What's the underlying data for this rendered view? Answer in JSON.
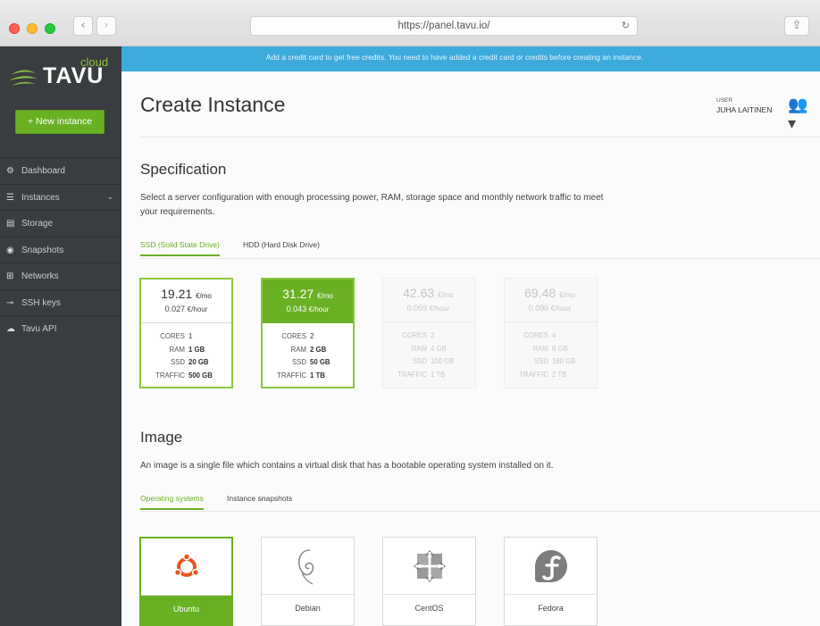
{
  "browser": {
    "url": "https://panel.tavu.io/",
    "back_icon": "‹",
    "forward_icon": "›",
    "sidebar_icon": "▯",
    "share_icon": "⇪",
    "reload_icon": "↻"
  },
  "brand": {
    "cloud": "cloud",
    "name": "TAVU",
    "accent_color": "#6ab023",
    "banner_color": "#3caadb"
  },
  "sidebar": {
    "new_instance_label": "+ New instance",
    "items": [
      {
        "label": "Dashboard",
        "icon": "⚙"
      },
      {
        "label": "Instances",
        "icon": "☰",
        "chevron": "⌄"
      },
      {
        "label": "Storage",
        "icon": "▤"
      },
      {
        "label": "Snapshots",
        "icon": "◉"
      },
      {
        "label": "Networks",
        "icon": "⊞"
      },
      {
        "label": "SSH keys",
        "icon": "⊸"
      },
      {
        "label": "Tavu API",
        "icon": "☁"
      }
    ]
  },
  "banner": {
    "text": "Add a credit card to get free credits. You need to have added a credit card or credits before creating an instance."
  },
  "header": {
    "title": "Create Instance",
    "user_label": "USER",
    "user_name": "JUHA LAITINEN",
    "user_icon": "👥▾"
  },
  "specification": {
    "title": "Specification",
    "description": "Select a server configuration with enough processing power, RAM, storage space and monthly network traffic to meet your requirements.",
    "tabs": [
      "SSD (Solid State Drive)",
      "HDD (Hard Disk Drive)"
    ],
    "active_tab": 0,
    "spec_labels": {
      "cores": "CORES",
      "ram": "RAM",
      "ssd": "SSD",
      "traffic": "TRAFFIC"
    },
    "plans": [
      {
        "price": "19.21",
        "price_unit": "€/mo",
        "hourly": "0.027",
        "hourly_unit": "€/hour",
        "cores": "1",
        "ram": "1 GB",
        "ssd": "20 GB",
        "traffic": "500 GB",
        "state": "available"
      },
      {
        "price": "31.27",
        "price_unit": "€/mo",
        "hourly": "0.043",
        "hourly_unit": "€/hour",
        "cores": "2",
        "ram": "2 GB",
        "ssd": "50 GB",
        "traffic": "1 TB",
        "state": "selected"
      },
      {
        "price": "42.63",
        "price_unit": "€/mo",
        "hourly": "0.059",
        "hourly_unit": "€/hour",
        "cores": "2",
        "ram": "4 GB",
        "ssd": "100 GB",
        "traffic": "1 TB",
        "state": "disabled"
      },
      {
        "price": "69.48",
        "price_unit": "€/mo",
        "hourly": "0.096",
        "hourly_unit": "€/hour",
        "cores": "4",
        "ram": "8 GB",
        "ssd": "160 GB",
        "traffic": "2 TB",
        "state": "disabled"
      }
    ]
  },
  "image": {
    "title": "Image",
    "description": "An image is a single file which contains a virtual disk that has a bootable operating system installed on it.",
    "tabs": [
      "Operating systems",
      "Instance snapshots"
    ],
    "active_tab": 0,
    "os": [
      {
        "name": "Ubuntu",
        "icon": "ubuntu-icon",
        "selected": true
      },
      {
        "name": "Debian",
        "icon": "debian-icon",
        "selected": false
      },
      {
        "name": "CentOS",
        "icon": "centos-icon",
        "selected": false
      },
      {
        "name": "Fedora",
        "icon": "fedora-icon",
        "selected": false
      }
    ]
  }
}
